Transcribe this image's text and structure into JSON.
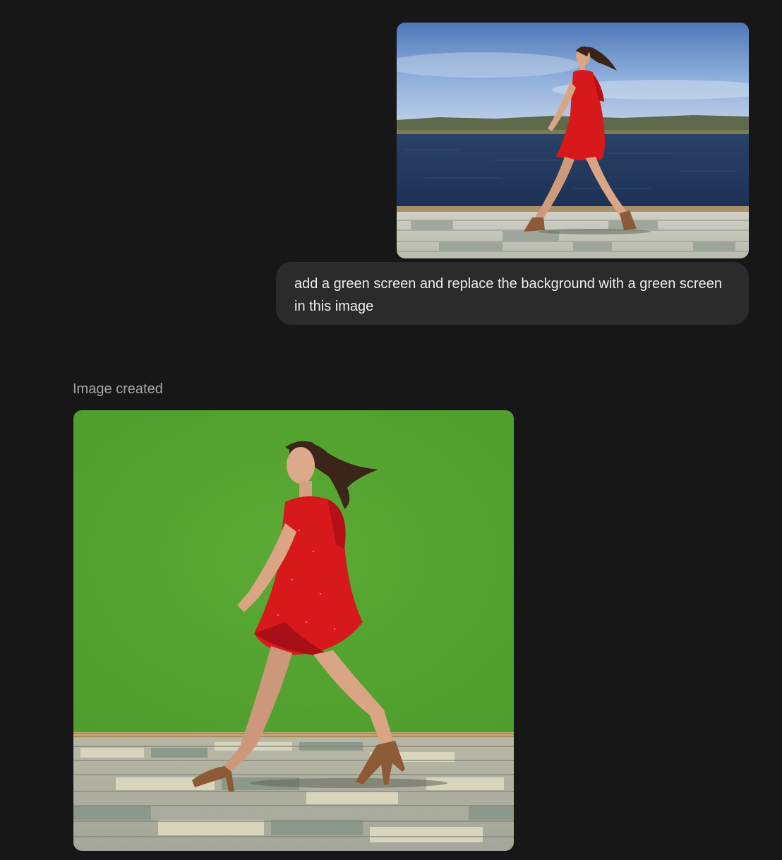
{
  "user_message": {
    "text": "add a green screen and replace the background with a green screen in this image",
    "attachment": {
      "kind": "photo",
      "subject": "woman in red dress walking on a tiled waterfront promenade"
    }
  },
  "assistant_message": {
    "status": "Image created",
    "generated_image": {
      "kind": "photo",
      "subject": "woman in red dress walking on tiled floor in front of a green screen"
    }
  },
  "colors": {
    "page_background": "#171717",
    "user_bubble": "#2b2b2b",
    "user_text": "#ececec",
    "status_text": "#a4a4a4",
    "green_screen": "#56a531",
    "dress": "#d8191c",
    "water": "#1f3558",
    "sky": "#6f93c9"
  }
}
